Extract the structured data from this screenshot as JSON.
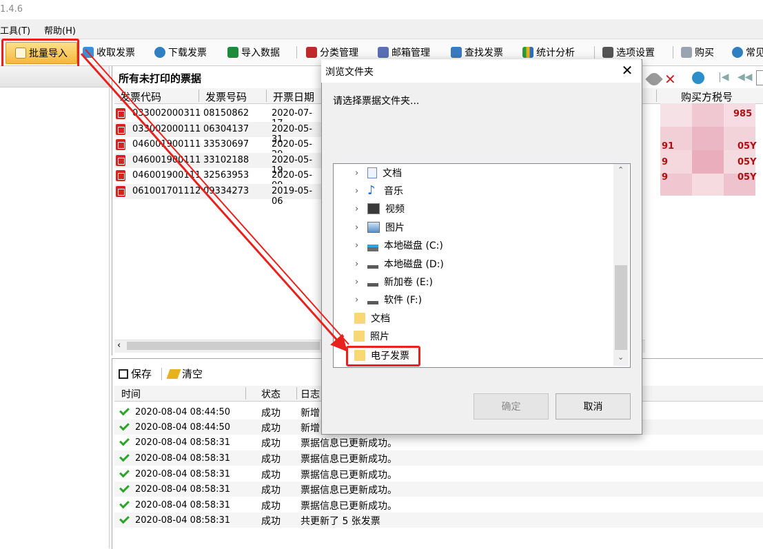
{
  "app": {
    "version": "1.4.6"
  },
  "menu": {
    "items": [
      {
        "label": "工具(T)"
      },
      {
        "label": "帮助(H)"
      }
    ]
  },
  "toolbar": {
    "batch_import": "批量导入",
    "receive_invoice": "收取发票",
    "download_invoice": "下载发票",
    "import_data": "导入数据",
    "category_manage": "分类管理",
    "mailbox_manage": "邮箱管理",
    "find_invoice": "查找发票",
    "statistics": "统计分析",
    "options": "选项设置",
    "buy": "购买",
    "faq": "常见"
  },
  "list": {
    "title": "所有未打印的票据",
    "columns": {
      "code": "发票代码",
      "number": "发票号码",
      "date": "开票日期",
      "buyer_tax": "购买方税号"
    },
    "rows": [
      {
        "code": "033002000311",
        "number": "08150862",
        "date": "2020-07-17"
      },
      {
        "code": "033002000111",
        "number": "06304137",
        "date": "2020-05-31"
      },
      {
        "code": "046001900111",
        "number": "33530697",
        "date": "2020-05-29"
      },
      {
        "code": "046001900111",
        "number": "33102188",
        "date": "2020-05-19"
      },
      {
        "code": "046001900111",
        "number": "32563953",
        "date": "2020-05-09"
      },
      {
        "code": "061001701112",
        "number": "09334273",
        "date": "2019-05-06"
      }
    ],
    "buyer_tax_fragments": [
      "985",
      "91",
      "05Y",
      "9",
      "05Y",
      "9",
      "05Y"
    ]
  },
  "log": {
    "save": "保存",
    "clear": "清空",
    "columns": {
      "time": "时间",
      "status": "状态",
      "log": "日志"
    },
    "rows": [
      {
        "time": "2020-08-04 08:44:50",
        "status": "成功",
        "message": "新增"
      },
      {
        "time": "2020-08-04 08:44:50",
        "status": "成功",
        "message": "新增"
      },
      {
        "time": "2020-08-04 08:58:31",
        "status": "成功",
        "message": "票据信息已更新成功。"
      },
      {
        "time": "2020-08-04 08:58:31",
        "status": "成功",
        "message": "票据信息已更新成功。"
      },
      {
        "time": "2020-08-04 08:58:31",
        "status": "成功",
        "message": "票据信息已更新成功。"
      },
      {
        "time": "2020-08-04 08:58:31",
        "status": "成功",
        "message": "票据信息已更新成功。"
      },
      {
        "time": "2020-08-04 08:58:31",
        "status": "成功",
        "message": "票据信息已更新成功。"
      },
      {
        "time": "2020-08-04 08:58:31",
        "status": "成功",
        "message": "共更新了 5 张发票"
      }
    ]
  },
  "dialog": {
    "title": "浏览文件夹",
    "prompt": "请选择票据文件夹...",
    "tree": [
      {
        "label": "文档",
        "icon": "document-icon"
      },
      {
        "label": "音乐",
        "icon": "music-icon"
      },
      {
        "label": "视频",
        "icon": "video-icon"
      },
      {
        "label": "图片",
        "icon": "picture-icon"
      },
      {
        "label": "本地磁盘 (C:)",
        "icon": "drive-icon"
      },
      {
        "label": "本地磁盘 (D:)",
        "icon": "drive-icon"
      },
      {
        "label": "新加卷 (E:)",
        "icon": "drive-icon"
      },
      {
        "label": "软件 (F:)",
        "icon": "drive-icon"
      },
      {
        "label": "文档",
        "icon": "folder-icon"
      },
      {
        "label": "照片",
        "icon": "folder-icon"
      },
      {
        "label": "电子发票",
        "icon": "folder-icon"
      }
    ],
    "ok": "确定",
    "cancel": "取消"
  },
  "colors": {
    "highlight": "#e8211d",
    "accent": "#f6b73c"
  }
}
